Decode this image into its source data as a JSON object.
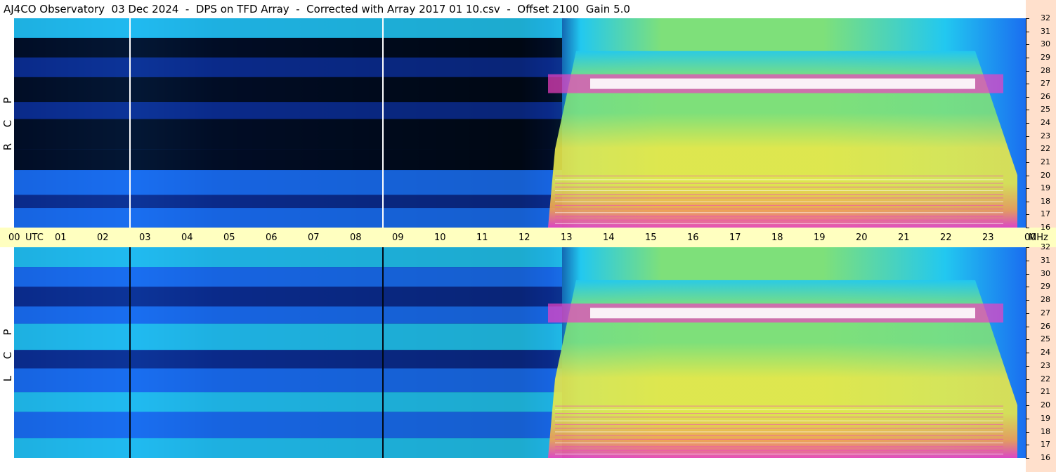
{
  "title": "AJ4CO Observatory  03 Dec 2024  -  DPS on TFD Array  -  Corrected with Array 2017 01 10.csv  -  Offset 2100  Gain 5.0",
  "utc_label": "UTC",
  "mhz_unit": "MHz",
  "top_polarization": [
    "R",
    "C",
    "P"
  ],
  "bottom_polarization": [
    "L",
    "C",
    "P"
  ],
  "colors": {
    "background_dark": "#000814",
    "deep_blue": "#0a2a8a",
    "mid_blue": "#1a6ef0",
    "cyan": "#22c8f0",
    "green": "#7ee07a",
    "yellow": "#e8e84a",
    "orange": "#f8a050",
    "magenta": "#f040c0",
    "white_hot": "#ffffff",
    "time_band": "#ffffc0",
    "right_strip": "#ffe0cc"
  },
  "chart_data": [
    {
      "type": "heatmap",
      "panel": "RCP",
      "x_axis": {
        "label": "UTC",
        "ticks": [
          "00",
          "01",
          "02",
          "03",
          "04",
          "05",
          "06",
          "07",
          "08",
          "09",
          "10",
          "11",
          "12",
          "13",
          "14",
          "15",
          "16",
          "17",
          "18",
          "19",
          "20",
          "21",
          "22",
          "23",
          "00"
        ],
        "range_hours": [
          0,
          24
        ]
      },
      "y_axis": {
        "unit": "MHz",
        "ticks": [
          16,
          17,
          18,
          19,
          20,
          21,
          22,
          23,
          24,
          25,
          26,
          27,
          28,
          29,
          30,
          31,
          32
        ],
        "range": [
          16,
          32
        ]
      },
      "features": {
        "vertical_markers_utc": [
          2.75,
          8.75
        ],
        "quiet_interval_utc": [
          2.8,
          13.0
        ],
        "active_interval_utc": [
          13.0,
          23.8
        ],
        "hot_band_mhz": [
          26.6,
          27.4
        ]
      }
    },
    {
      "type": "heatmap",
      "panel": "LCP",
      "x_axis": {
        "label": "UTC",
        "ticks": [
          "00",
          "01",
          "02",
          "03",
          "04",
          "05",
          "06",
          "07",
          "08",
          "09",
          "10",
          "11",
          "12",
          "13",
          "14",
          "15",
          "16",
          "17",
          "18",
          "19",
          "20",
          "21",
          "22",
          "23",
          "00"
        ],
        "range_hours": [
          0,
          24
        ]
      },
      "y_axis": {
        "unit": "MHz",
        "ticks": [
          16,
          17,
          18,
          19,
          20,
          21,
          22,
          23,
          24,
          25,
          26,
          27,
          28,
          29,
          30,
          31,
          32
        ],
        "range": [
          16,
          32
        ]
      },
      "features": {
        "vertical_markers_utc": [
          2.75,
          8.75
        ],
        "quiet_interval_utc": [
          2.8,
          13.0
        ],
        "active_interval_utc": [
          13.0,
          23.8
        ],
        "hot_band_mhz": [
          26.6,
          27.4
        ]
      }
    }
  ]
}
